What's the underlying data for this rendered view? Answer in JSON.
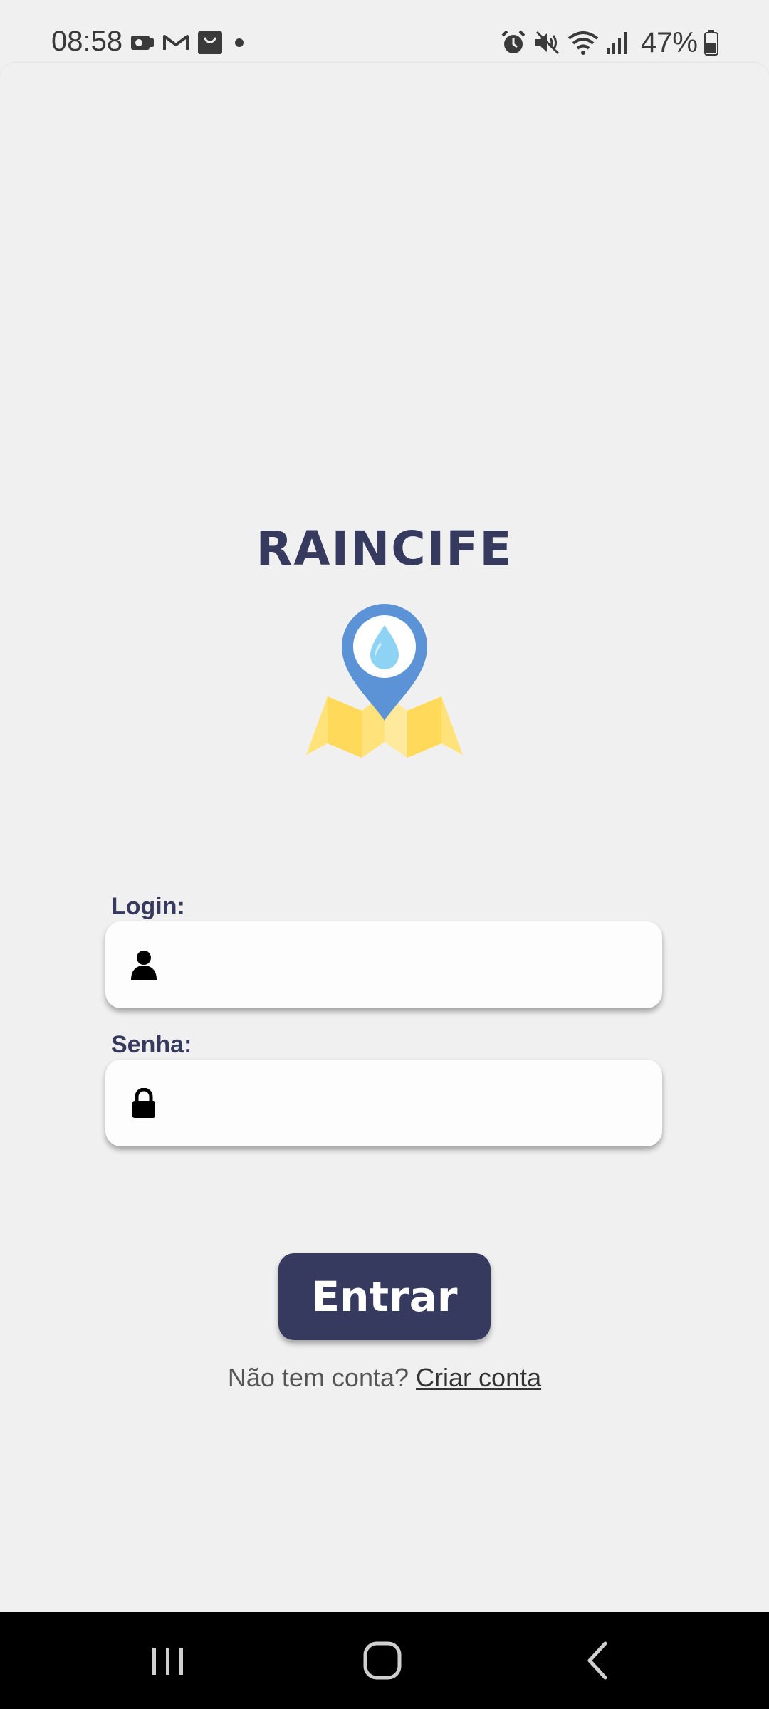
{
  "status_bar": {
    "time": "08:58",
    "battery": "47%",
    "left_icons": [
      "gallery-icon",
      "gmail-icon",
      "shopping-bag-icon",
      "dot-icon"
    ],
    "right_icons": [
      "alarm-icon",
      "mute-icon",
      "wifi-icon",
      "signal-icon",
      "battery-icon"
    ]
  },
  "app": {
    "title": "RAINCIFE",
    "logo": "map-pin-raindrop-logo"
  },
  "form": {
    "login_label": "Login:",
    "login_value": "",
    "login_icon": "user-icon",
    "password_label": "Senha:",
    "password_value": "",
    "password_icon": "lock-icon",
    "submit_label": "Entrar"
  },
  "signup": {
    "prompt": "Não tem conta?",
    "link_label": "Criar conta"
  },
  "nav_bar": {
    "buttons": [
      "recent-apps-icon",
      "home-icon",
      "back-icon"
    ]
  },
  "colors": {
    "primary": "#363a5e",
    "background": "#f0f0f0",
    "input_bg": "#fdfdfd",
    "pin_blue": "#5b93d6",
    "drop_blue": "#8fd3f4",
    "map_yellow": "#ffe27a"
  }
}
